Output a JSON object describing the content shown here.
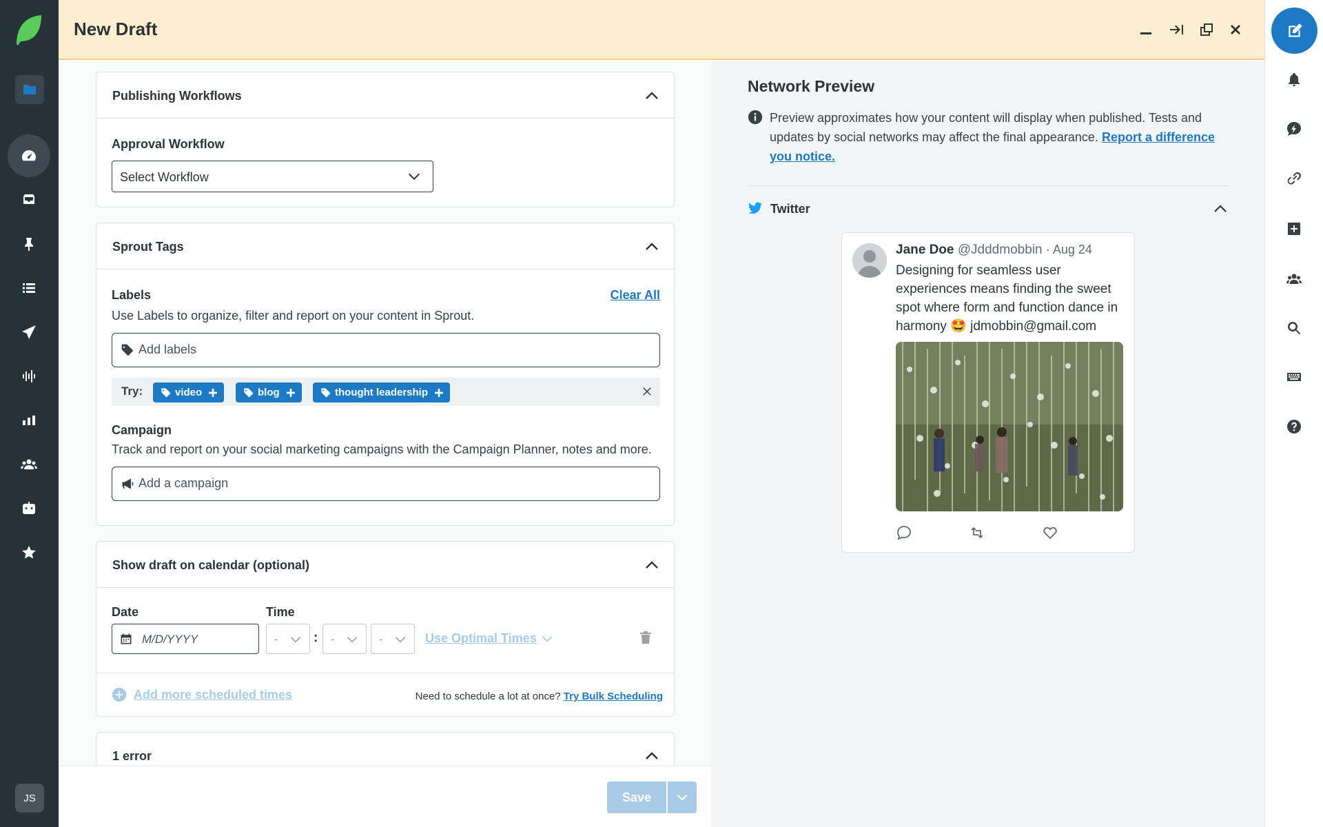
{
  "header": {
    "title": "New Draft"
  },
  "publishing": {
    "title": "Publishing Workflows",
    "approval_label": "Approval Workflow",
    "workflow_value": "Select Workflow"
  },
  "tags": {
    "title": "Sprout Tags",
    "labels_label": "Labels",
    "clear_all": "Clear All",
    "labels_help": "Use Labels to organize, filter and report on your content in Sprout.",
    "labels_placeholder": "Add labels",
    "try_label": "Try:",
    "suggestions": [
      "video",
      "blog",
      "thought leadership"
    ],
    "campaign_label": "Campaign",
    "campaign_help": "Track and report on your social marketing campaigns with the Campaign Planner, notes and more.",
    "campaign_placeholder": "Add a campaign"
  },
  "calendar": {
    "title": "Show draft on calendar (optional)",
    "date_label": "Date",
    "time_label": "Time",
    "date_placeholder": "M/D/YYYY",
    "hour": "-",
    "minute": "-",
    "ampm": "-",
    "colon": ":",
    "optimal": "Use Optimal Times",
    "add_more": "Add more scheduled times",
    "bulk_prompt": "Need to schedule a lot at once?",
    "bulk_link": "Try Bulk Scheduling"
  },
  "errors": {
    "title": "1 error"
  },
  "footer": {
    "save": "Save"
  },
  "preview": {
    "title": "Network Preview",
    "info": "Preview approximates how your content will display when published. Tests and updates by social networks may affect the final appearance.",
    "report_link": "Report a difference you notice.",
    "network": "Twitter",
    "tweet": {
      "name": "Jane Doe",
      "handle": "@Jdddmobbin",
      "date": "· Aug 24",
      "text": "Designing for seamless user experiences means finding the sweet spot where form and function dance in harmony 🤩 jdmobbin@gmail.com"
    }
  },
  "user": {
    "initials": "JS"
  },
  "colors": {
    "brand_green": "#59cb59",
    "accent_blue": "#1c79c3",
    "header_bg": "#fbefcf",
    "nav_bg": "#273238"
  },
  "icons": {
    "left_nav": [
      "folder-icon",
      "dashboard-icon",
      "inbox-icon",
      "pin-icon",
      "list-icon",
      "send-icon",
      "listening-icon",
      "reports-icon",
      "people-icon",
      "bot-icon",
      "star-icon"
    ],
    "right_rail": [
      "compose-icon",
      "bell-icon",
      "activity-icon",
      "link-icon",
      "add-icon",
      "team-icon",
      "search-icon",
      "keyboard-icon",
      "help-icon"
    ]
  }
}
